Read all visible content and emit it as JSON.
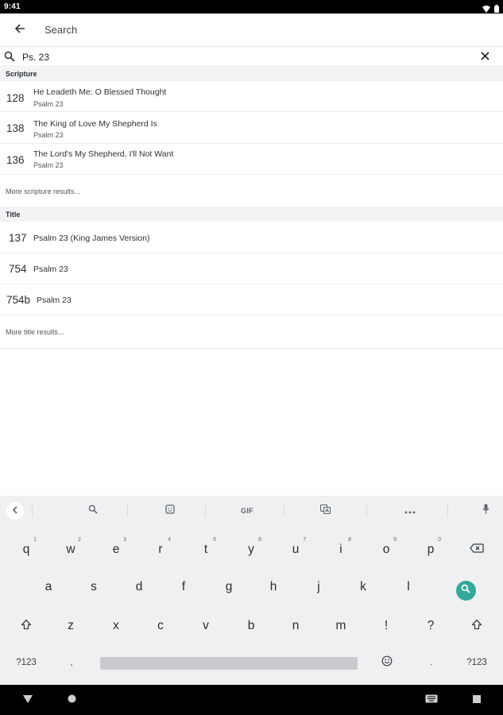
{
  "status_bar": {
    "time": "9:41",
    "icons": [
      "wifi-icon",
      "battery-icon"
    ]
  },
  "app_bar": {
    "title": "Search",
    "back_icon": "arrow-back-icon"
  },
  "search": {
    "value": "Ps. 23",
    "search_icon": "search-icon",
    "clear_icon": "close-icon"
  },
  "sections": [
    {
      "header": "Scripture",
      "results": [
        {
          "number": "128",
          "title": "He Leadeth Me: O Blessed Thought",
          "subtitle": "Psalm 23"
        },
        {
          "number": "138",
          "title": "The King of Love My Shepherd Is",
          "subtitle": "Psalm 23"
        },
        {
          "number": "136",
          "title": "The Lord's My Shepherd, I'll Not Want",
          "subtitle": "Psalm 23"
        }
      ],
      "more_label": "More scripture results..."
    },
    {
      "header": "Title",
      "results": [
        {
          "number": "137",
          "title": "Psalm 23 (King James Version)"
        },
        {
          "number": "754",
          "title": "Psalm 23"
        },
        {
          "number": "754b",
          "title": "Psalm 23"
        }
      ],
      "more_label": "More title results..."
    }
  ],
  "keyboard": {
    "toolbar": {
      "collapse_icon": "chevron-left-icon",
      "search_icon": "search-icon",
      "sticker_icon": "sticker-icon",
      "gif_label": "GIF",
      "translate_icon": "translate-icon",
      "more_icon": "more-horizontal-icon",
      "mic_icon": "microphone-icon"
    },
    "row1": [
      {
        "key": "q",
        "hint": "1"
      },
      {
        "key": "w",
        "hint": "2"
      },
      {
        "key": "e",
        "hint": "3"
      },
      {
        "key": "r",
        "hint": "4"
      },
      {
        "key": "t",
        "hint": "5"
      },
      {
        "key": "y",
        "hint": "6"
      },
      {
        "key": "u",
        "hint": "7"
      },
      {
        "key": "i",
        "hint": "8"
      },
      {
        "key": "o",
        "hint": "9"
      },
      {
        "key": "p",
        "hint": "0"
      }
    ],
    "row2": [
      "a",
      "s",
      "d",
      "f",
      "g",
      "h",
      "j",
      "k",
      "l"
    ],
    "row3": [
      "z",
      "x",
      "c",
      "v",
      "b",
      "n",
      "m",
      "!",
      "?"
    ],
    "row4": {
      "symbols_left": "?123",
      "comma": ",",
      "period": ".",
      "symbols_right": "?123",
      "emoji_icon": "emoji-icon"
    },
    "backspace_icon": "backspace-icon",
    "shift_icon": "shift-icon",
    "action_icon": "search-icon"
  },
  "nav_bar": {
    "icons": [
      "back-triangle-icon",
      "home-circle-icon",
      "keyboard-switch-icon",
      "recents-square-icon"
    ]
  }
}
